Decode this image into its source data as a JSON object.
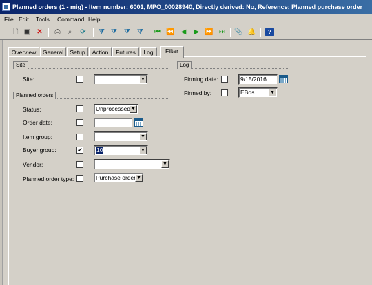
{
  "window": {
    "title": "Planned orders (1 - mig) - Item number: 6001, MPO_00028940, Directly derived: No, Reference: Planned purchase order"
  },
  "menubar": {
    "items": [
      "File",
      "Edit",
      "Tools",
      "Command",
      "Help"
    ]
  },
  "toolbar": {
    "icons": [
      "new-icon",
      "save-icon",
      "delete-icon",
      "print-icon",
      "print-preview-icon",
      "refresh-icon",
      "filter-by-selection-icon",
      "filter-by-grid-icon",
      "advanced-filter-icon",
      "remove-filter-icon",
      "first-record-icon",
      "previous-page-icon",
      "previous-record-icon",
      "next-record-icon",
      "next-page-icon",
      "last-record-icon",
      "document-handling-icon",
      "alerts-icon",
      "help-icon"
    ]
  },
  "tabs": [
    "Overview",
    "General",
    "Setup",
    "Action",
    "Futures",
    "Log",
    "Filter"
  ],
  "filter": {
    "site_group": "Site",
    "site": {
      "label": "Site:",
      "value": ""
    },
    "planned_orders_group": "Planned orders",
    "status": {
      "label": "Status:",
      "value": "Unprocessed"
    },
    "order_date": {
      "label": "Order date:",
      "value": ""
    },
    "item_group": {
      "label": "Item group:",
      "value": ""
    },
    "buyer_group": {
      "label": "Buyer group:",
      "value": "10",
      "checked": true,
      "check_glyph": "✔"
    },
    "vendor": {
      "label": "Vendor:",
      "value": ""
    },
    "planned_order_type": {
      "label": "Planned order type:",
      "value": "Purchase order"
    },
    "log_group": "Log",
    "firming_date": {
      "label": "Firming date:",
      "value": "9/15/2016"
    },
    "firmed_by": {
      "label": "Firmed by:",
      "value": "EBos"
    }
  }
}
